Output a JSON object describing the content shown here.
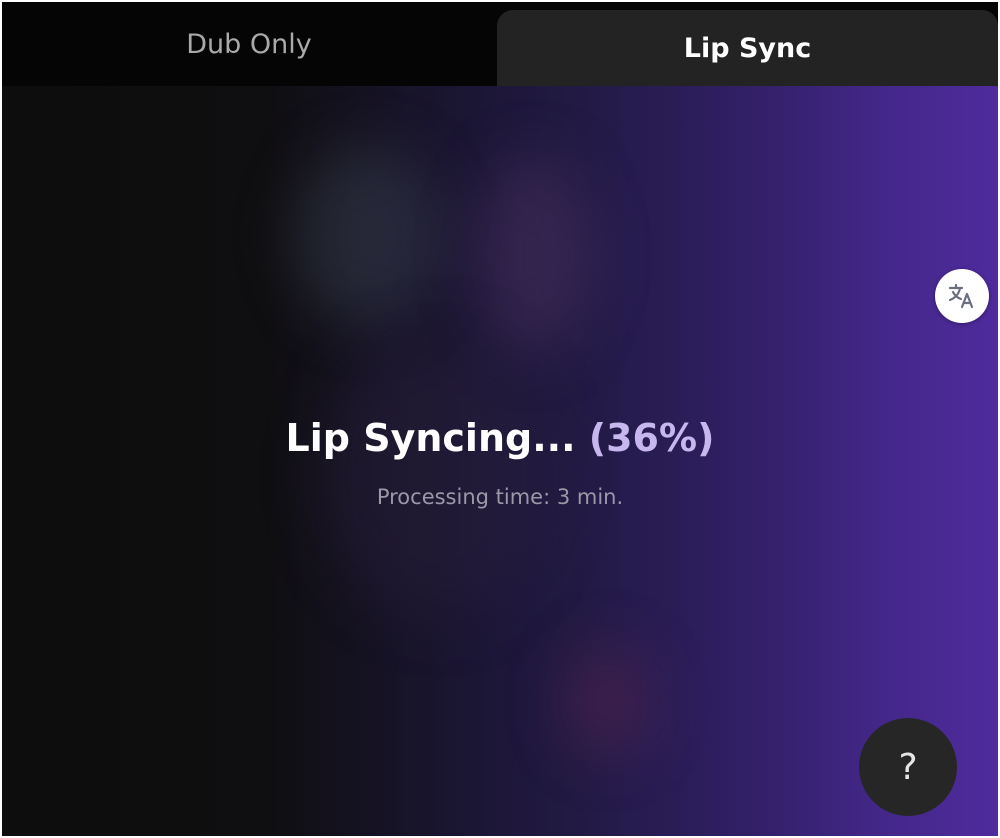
{
  "tabs": {
    "dub_only": "Dub Only",
    "lip_sync": "Lip Sync",
    "active": "lip_sync"
  },
  "status": {
    "title": "Lip Syncing...",
    "progress_text": "(36%)",
    "progress_percent": 36,
    "subtitle": "Processing time: 3 min."
  },
  "icons": {
    "translate": "translate-icon",
    "help_glyph": "?"
  },
  "colors": {
    "accent": "#c6b7ef",
    "gradient_end": "#4f2b9d",
    "active_tab_bg": "#232323"
  }
}
